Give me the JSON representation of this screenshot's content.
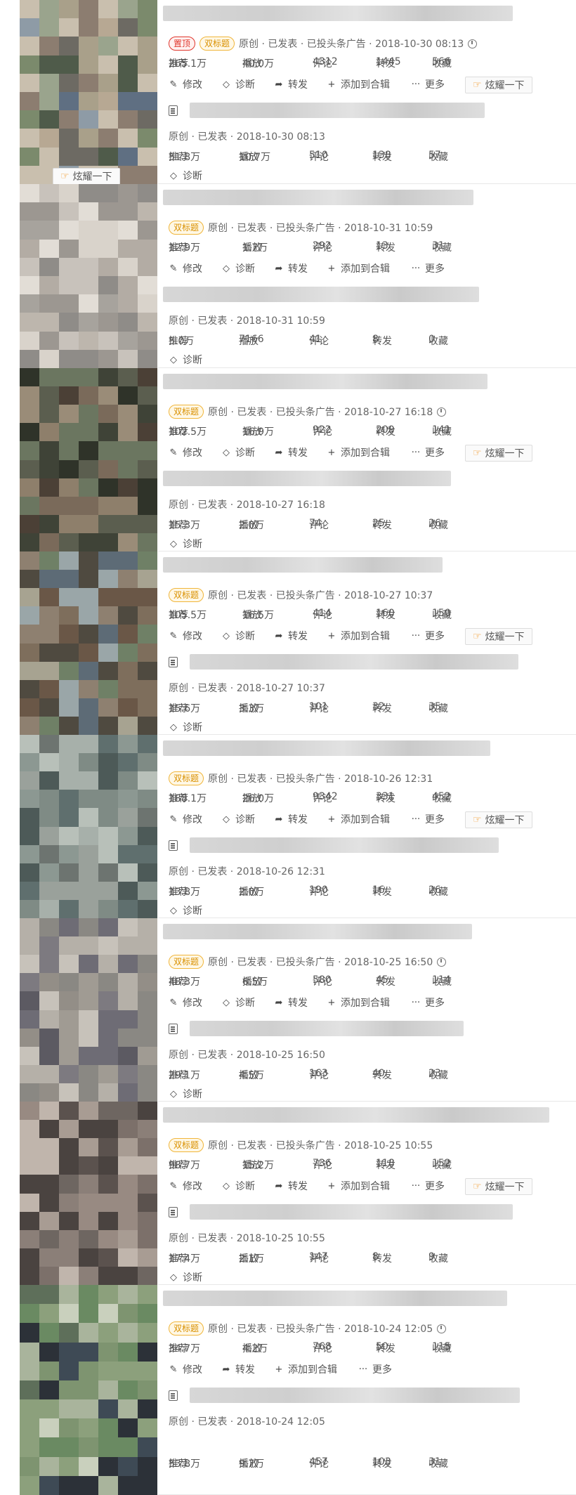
{
  "labels": {
    "edit": "修改",
    "diagnose": "诊断",
    "share": "转发",
    "add_collection": "添加到合辑",
    "more": "更多",
    "show_off": "炫耀一下",
    "badge_top": "置顶",
    "badge_dual": "双标题",
    "rec": "推荐",
    "play": "播放",
    "comment": "评论",
    "forward": "转发",
    "fav": "收藏"
  },
  "icons": {
    "edit": "pencil-icon",
    "diagnose": "diamond-icon",
    "share": "share-arrow-icon",
    "add": "plus-icon",
    "more": "ellipsis-icon",
    "show_off": "hand-point-icon",
    "clock": "clock-icon",
    "doc": "document-icon"
  },
  "items": [
    {
      "meta": "原创 · 已发表 · 已投头条广告 · 2018-10-30 08:13",
      "rec": "265.1万",
      "play": "40.0万",
      "comment": "4312",
      "forward": "1445",
      "fav": "566",
      "sub_meta": "原创 · 已发表 · 2018-10-30 08:13",
      "sub_rec": "51.8万",
      "sub_play": "10.7万",
      "sub_comment": "510",
      "sub_forward": "138",
      "sub_fav": "57"
    },
    {
      "meta": "原创 · 已发表 · 已投头条广告 · 2018-10-31 10:59",
      "rec": "12.9万",
      "play": "1.7万",
      "comment": "292",
      "forward": "13",
      "fav": "31",
      "sub_meta": "原创 · 已发表 · 2018-10-31 10:59",
      "sub_rec": "5.0万",
      "sub_play": "7166",
      "sub_comment": "41",
      "sub_forward": "8",
      "sub_fav": "0"
    },
    {
      "meta": "原创 · 已发表 · 已投头条广告 · 2018-10-27 16:18",
      "rec": "102.5万",
      "play": "16.9万",
      "comment": "922",
      "forward": "209",
      "fav": "141",
      "sub_meta": "原创 · 已发表 · 2018-10-27 16:18",
      "sub_rec": "15.3万",
      "sub_play": "2.0万",
      "sub_comment": "74",
      "sub_forward": "25",
      "sub_fav": "26"
    },
    {
      "meta": "原创 · 已发表 · 已投头条广告 · 2018-10-27 10:37",
      "rec": "105.5万",
      "play": "16.5万",
      "comment": "414",
      "forward": "160",
      "fav": "150",
      "sub_meta": "原创 · 已发表 · 2018-10-27 10:37",
      "sub_rec": "15.6万",
      "sub_play": "3.3万",
      "sub_comment": "101",
      "sub_forward": "32",
      "sub_fav": "35"
    },
    {
      "meta": "原创 · 已发表 · 已投头条广告 · 2018-10-26 12:31",
      "rec": "188.1万",
      "play": "26.0万",
      "comment": "9342",
      "forward": "331",
      "fav": "452",
      "sub_meta": "原创 · 已发表 · 2018-10-26 12:31",
      "sub_rec": "13.8万",
      "sub_play": "2.0万",
      "sub_comment": "190",
      "sub_forward": "16",
      "sub_fav": "26"
    },
    {
      "meta": "原创 · 已发表 · 已投头条广告 · 2018-10-25 16:50",
      "rec": "48.3万",
      "play": "6.5万",
      "comment": "580",
      "forward": "45",
      "fav": "114",
      "sub_meta": "原创 · 已发表 · 2018-10-25 16:50",
      "sub_rec": "29.1万",
      "sub_play": "4.5万",
      "sub_comment": "163",
      "sub_forward": "40",
      "sub_fav": "23"
    },
    {
      "meta": "原创 · 已发表 · 已投头条广告 · 2018-10-25 10:55",
      "rec": "98.7万",
      "play": "15.2万",
      "comment": "736",
      "forward": "118",
      "fav": "152",
      "sub_meta": "原创 · 已发表 · 2018-10-25 10:55",
      "sub_rec": "17.4万",
      "sub_play": "2.1万",
      "sub_comment": "147",
      "sub_forward": "8",
      "sub_fav": "9"
    },
    {
      "meta": "原创 · 已发表 · 已投头条广告 · 2018-10-24 12:05",
      "rec": "34.7万",
      "play": "4.2万",
      "comment": "768",
      "forward": "50",
      "fav": "115",
      "sub_meta": "原创 · 已发表 · 2018-10-24 12:05",
      "sub_rec": "53.8万",
      "sub_play": "9.7万",
      "sub_comment": "457",
      "sub_forward": "103",
      "sub_fav": "31"
    }
  ]
}
